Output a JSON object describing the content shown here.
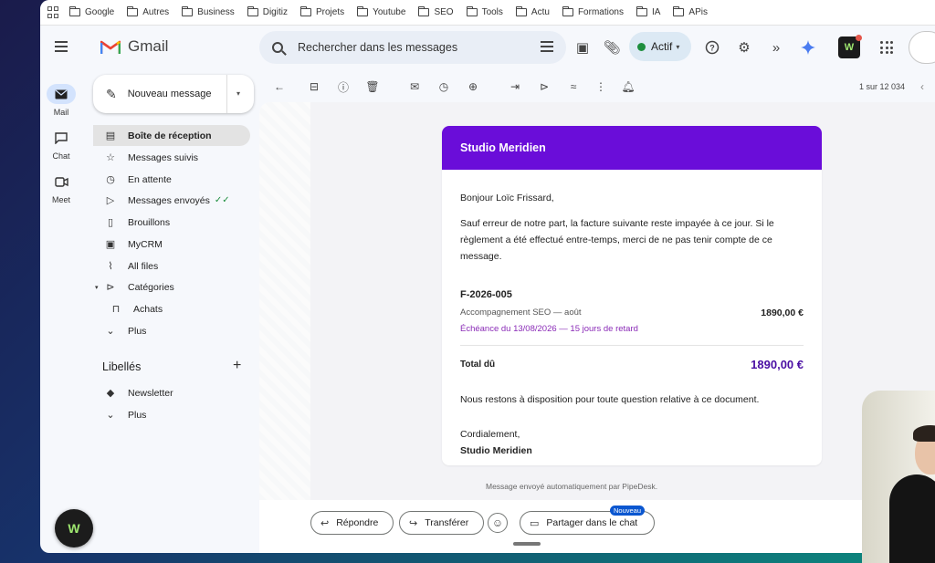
{
  "bookmarks": [
    "Google",
    "Autres",
    "Business",
    "Digitiz",
    "Projets",
    "Youtube",
    "SEO",
    "Tools",
    "Actu",
    "Formations",
    "IA",
    "APis"
  ],
  "header": {
    "app_name": "Gmail",
    "search_placeholder": "Rechercher dans les messages",
    "status": "Actif"
  },
  "rail": [
    {
      "label": "Mail",
      "icon": "mail-icon"
    },
    {
      "label": "Chat",
      "icon": "chat-icon"
    },
    {
      "label": "Meet",
      "icon": "video-icon"
    }
  ],
  "compose": {
    "label": "Nouveau message"
  },
  "nav": [
    {
      "label": "Boîte de réception",
      "icon": "inbox-icon"
    },
    {
      "label": "Messages suivis",
      "icon": "star-icon"
    },
    {
      "label": "En attente",
      "icon": "clock-icon"
    },
    {
      "label": "Messages envoyés",
      "icon": "send-icon"
    },
    {
      "label": "Brouillons",
      "icon": "draft-icon"
    },
    {
      "label": "MyCRM",
      "icon": "contact-card-icon"
    },
    {
      "label": "All files",
      "icon": "paperclip-icon"
    },
    {
      "label": "Catégories",
      "icon": "label-icon"
    },
    {
      "label": "Achats",
      "icon": "shopping-icon"
    },
    {
      "label": "Plus",
      "icon": "chevron-down-icon"
    }
  ],
  "labels": {
    "title": "Libellés",
    "items": [
      {
        "label": "Newsletter",
        "icon": "label-filled-icon"
      },
      {
        "label": "Plus",
        "icon": "chevron-down-icon"
      }
    ]
  },
  "toolbar": {
    "pager": "1 sur 12 034"
  },
  "email": {
    "brand": "Studio Meridien",
    "greeting": "Bonjour Loïc Frissard,",
    "body": "Sauf erreur de notre part, la facture suivante reste impayée à ce jour. Si le règlement a été effectué entre-temps, merci de ne pas tenir compte de ce message.",
    "invoice_number": "F-2026-005",
    "invoice_desc": "Accompagnement SEO — août",
    "invoice_amount": "1890,00 €",
    "invoice_due": "Échéance du 13/08/2026 — 15 jours de retard",
    "total_label": "Total dû",
    "total_amount": "1890,00 €",
    "closing_text": "Nous restons à disposition pour toute question relative à ce document.",
    "signoff": "Cordialement,",
    "signature": "Studio Meridien",
    "footnote": "Message envoyé automatiquement par PipeDesk."
  },
  "actions": {
    "reply": "Répondre",
    "forward": "Transférer",
    "share_chat": "Partager dans le chat",
    "new_badge": "Nouveau"
  },
  "colors": {
    "accent_purple": "#6a0dd9",
    "total_purple": "#4a0fa3",
    "active_green": "#1e8e3e"
  }
}
